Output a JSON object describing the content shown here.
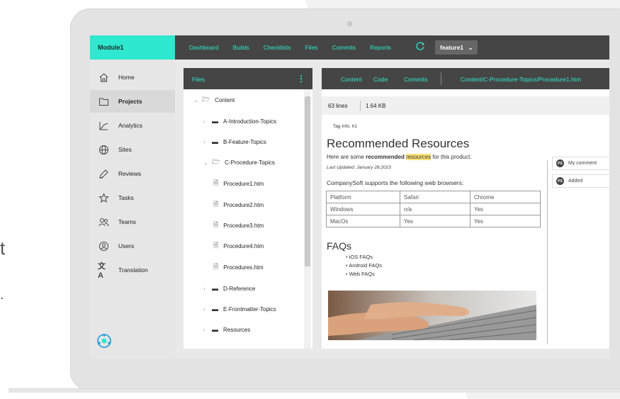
{
  "edge_text": [
    "t",
    "."
  ],
  "topbar": {
    "module": "Module1",
    "nav": [
      "Dashboard",
      "Builds",
      "Checklists",
      "Files",
      "Commits",
      "Reports"
    ],
    "branch": "feature1",
    "refresh_icon": "refresh-icon",
    "accent": "#2ee8cf",
    "bar_color": "#454545"
  },
  "sidebar": {
    "items": [
      {
        "label": "Home",
        "icon": "home-icon"
      },
      {
        "label": "Projects",
        "icon": "folder-icon",
        "active": true
      },
      {
        "label": "Analytics",
        "icon": "analytics-icon"
      },
      {
        "label": "Sites",
        "icon": "globe-icon"
      },
      {
        "label": "Reviews",
        "icon": "pen-icon"
      },
      {
        "label": "Tasks",
        "icon": "star-icon"
      },
      {
        "label": "Teams",
        "icon": "users-icon"
      },
      {
        "label": "Users",
        "icon": "user-circle-icon"
      },
      {
        "label": "Translation",
        "icon": "translate-icon"
      }
    ]
  },
  "files": {
    "title": "Files",
    "tree": [
      {
        "label": "Content",
        "type": "folder-open",
        "expanded": true
      },
      {
        "label": "A-Introduction-Topics",
        "type": "folder"
      },
      {
        "label": "B-Feature-Topics",
        "type": "folder"
      },
      {
        "label": "C-Procedure-Topics",
        "type": "folder-open",
        "expanded": true
      },
      {
        "label": "Procedure1.htm",
        "type": "file"
      },
      {
        "label": "Procedure2.htm",
        "type": "file"
      },
      {
        "label": "Procedure3.htm",
        "type": "file"
      },
      {
        "label": "Procedure4.htm",
        "type": "file"
      },
      {
        "label": "Procedures.htm",
        "type": "file"
      },
      {
        "label": "D-Reference",
        "type": "folder"
      },
      {
        "label": "E-Frontmatter-Topics",
        "type": "folder"
      },
      {
        "label": "Resources",
        "type": "folder"
      }
    ]
  },
  "content": {
    "tabs": [
      "Content",
      "Code",
      "Commits"
    ],
    "path": "Content/C-Procedure-Topics/Procedure1.htm",
    "lines": "63 lines",
    "size": "1.64 KB",
    "tag_info": "Tag Info: h1",
    "heading": "Recommended Resources",
    "intro_pre": "Here are some ",
    "intro_bold": "recommended",
    "intro_highlight": "resources",
    "intro_post": " for this product.",
    "last_updated": "Last Updated: January 28,2023",
    "supports": "CompanySoft supports the following web browsers:",
    "table": [
      [
        "Platform",
        "Safari",
        "Chrome"
      ],
      [
        "Windows",
        "n/a",
        "Yes"
      ],
      [
        "MacOs",
        "Yes",
        "Yes"
      ]
    ],
    "faqs_heading": "FAQs",
    "faqs": [
      "iOS FAQs",
      "Android FAQs",
      "Web FAQs"
    ]
  },
  "comments": [
    {
      "initials": "PS",
      "text": "My comment"
    },
    {
      "initials": "PS",
      "text": "Added"
    }
  ]
}
